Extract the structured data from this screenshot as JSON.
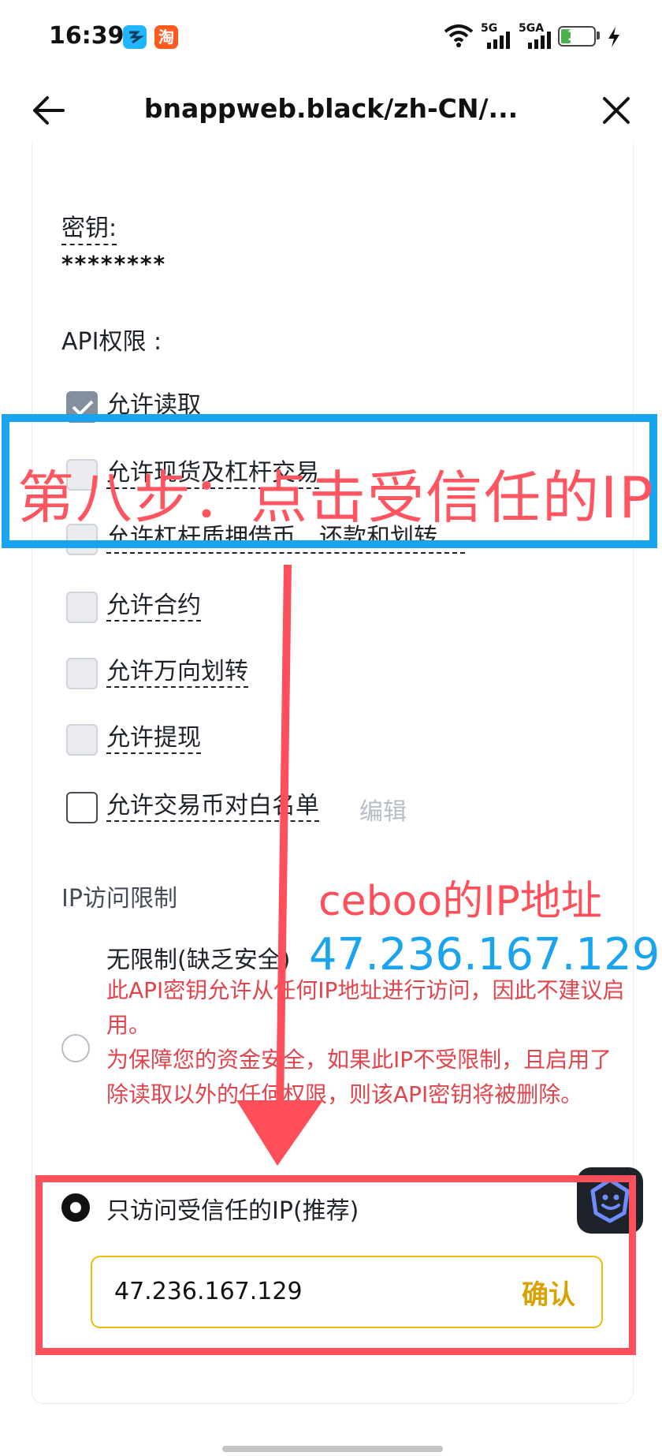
{
  "status_bar": {
    "time": "16:39",
    "taobao_icon_label": "淘",
    "signal1": "5G",
    "signal2": "5GA",
    "battery": "13"
  },
  "nav": {
    "back_icon": "back-arrow-icon",
    "title": "bnappweb.black/zh-CN/...",
    "close_icon": "close-icon"
  },
  "secret": {
    "label": "密钥:",
    "value": "********"
  },
  "permissions": {
    "title": "API权限 :",
    "items": [
      {
        "label": "允许读取",
        "checked": true
      },
      {
        "label": "允许现货及杠杆交易",
        "checked": false
      },
      {
        "label": "允许杠杆质押借币、还款和划转",
        "checked": false
      },
      {
        "label": "允许合约",
        "checked": false
      },
      {
        "label": "允许万向划转",
        "checked": false
      },
      {
        "label": "允许提现",
        "checked": false
      },
      {
        "label": "允许交易币对白名单",
        "checked": false
      }
    ],
    "edit_label": "编辑"
  },
  "ip_restriction": {
    "title": "IP访问限制",
    "unrestricted": {
      "label": "无限制(缺乏安全)",
      "warning1": "此API密钥允许从任何IP地址进行访问，因此不建议启用。",
      "warning2": "为保障您的资金安全，如果此IP不受限制，且启用了除读取以外的任何权限，则该API密钥将被删除。"
    },
    "trusted": {
      "label": "只访问受信任的IP(推荐)",
      "ip_value": "47.236.167.129",
      "confirm_label": "确认"
    }
  },
  "annotations": {
    "step": "第八步：点击受信任的IP",
    "ceboo_label": "ceboo的IP地址",
    "ceboo_ip": "47.236.167.129"
  },
  "colors": {
    "accent_yellow": "#f0b90b",
    "annotation_red": "#ff4f5a",
    "annotation_blue": "#1aa3ef"
  }
}
